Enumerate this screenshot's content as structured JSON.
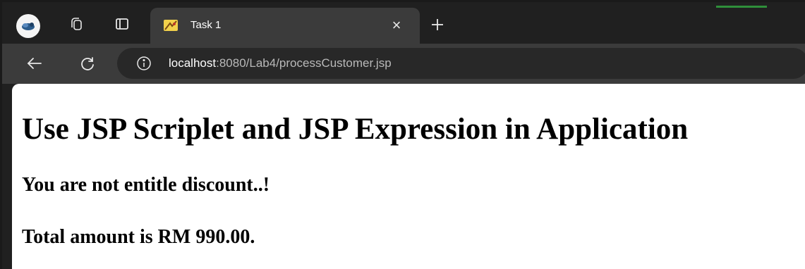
{
  "browser": {
    "tab": {
      "title": "Task 1",
      "close_glyph": "×"
    },
    "toolbar": {
      "url_host": "localhost",
      "url_rest": ":8080/Lab4/processCustomer.jsp"
    },
    "icons": [
      "profile-icon",
      "workspaces-icon",
      "tab-actions-icon",
      "tomcat-favicon",
      "close-icon",
      "new-tab-icon",
      "back-icon",
      "refresh-icon",
      "info-icon"
    ]
  },
  "page": {
    "heading": "Use JSP Scriplet and JSP Expression in Application",
    "discount_message": "You are not entitle discount..!",
    "total_message": "Total amount is RM 990.00."
  }
}
